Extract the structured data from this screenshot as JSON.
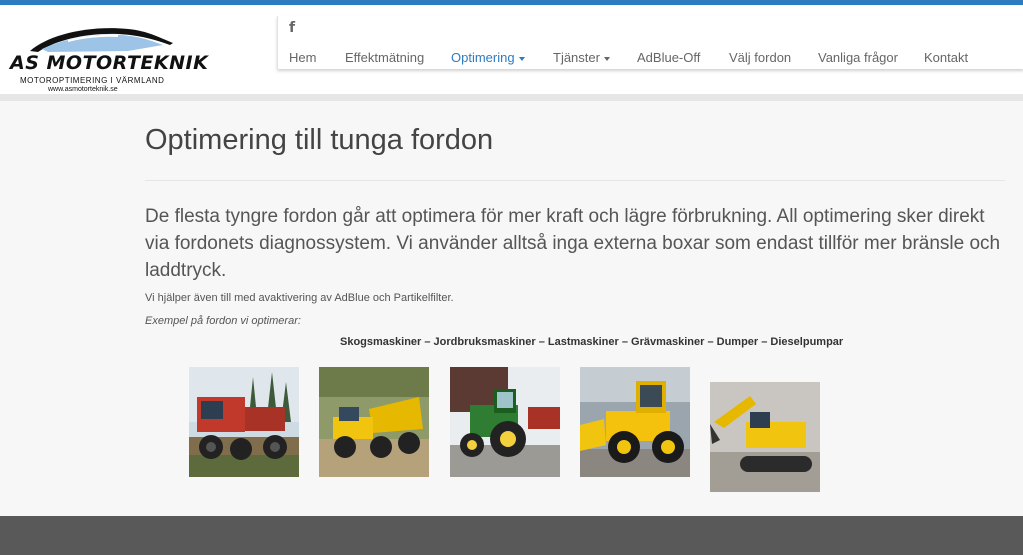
{
  "logo": {
    "name": "AS MOTORTEKNIK",
    "tagline": "MOTOROPTIMERING I VÄRMLAND",
    "url": "www.asmotorteknik.se"
  },
  "social": {
    "facebook_icon": "f"
  },
  "nav": {
    "items": [
      {
        "label": "Hem"
      },
      {
        "label": "Effektmätning"
      },
      {
        "label": "Optimering",
        "dropdown": true,
        "active": true
      },
      {
        "label": "Tjänster",
        "dropdown": true
      },
      {
        "label": "AdBlue-Off"
      },
      {
        "label": "Välj fordon"
      },
      {
        "label": "Vanliga frågor"
      },
      {
        "label": "Kontakt"
      }
    ]
  },
  "colors": {
    "accent": "#2e7cc0",
    "text": "#555555",
    "footer": "#595959"
  },
  "page": {
    "title": "Optimering till tunga fordon",
    "lead": "De flesta tyngre fordon går att optimera för mer kraft och lägre förbrukning. All optimering sker direkt via fordonets diagnossystem. Vi använder alltså inga externa boxar som endast tillför mer bränsle och laddtryck.",
    "note": "Vi hjälper även till med avaktivering av AdBlue och Partikelfilter.",
    "examples_label": "Exempel på fordon vi optimerar:",
    "vehicle_types": "Skogsmaskiner – Jordbruksmaskiner – Lastmaskiner – Grävmaskiner – Dumper – Dieselpumpar"
  },
  "photos": [
    {
      "name": "forestry-machine-photo"
    },
    {
      "name": "dumper-photo"
    },
    {
      "name": "tractor-photo"
    },
    {
      "name": "wheel-loader-photo"
    },
    {
      "name": "excavator-photo"
    }
  ]
}
